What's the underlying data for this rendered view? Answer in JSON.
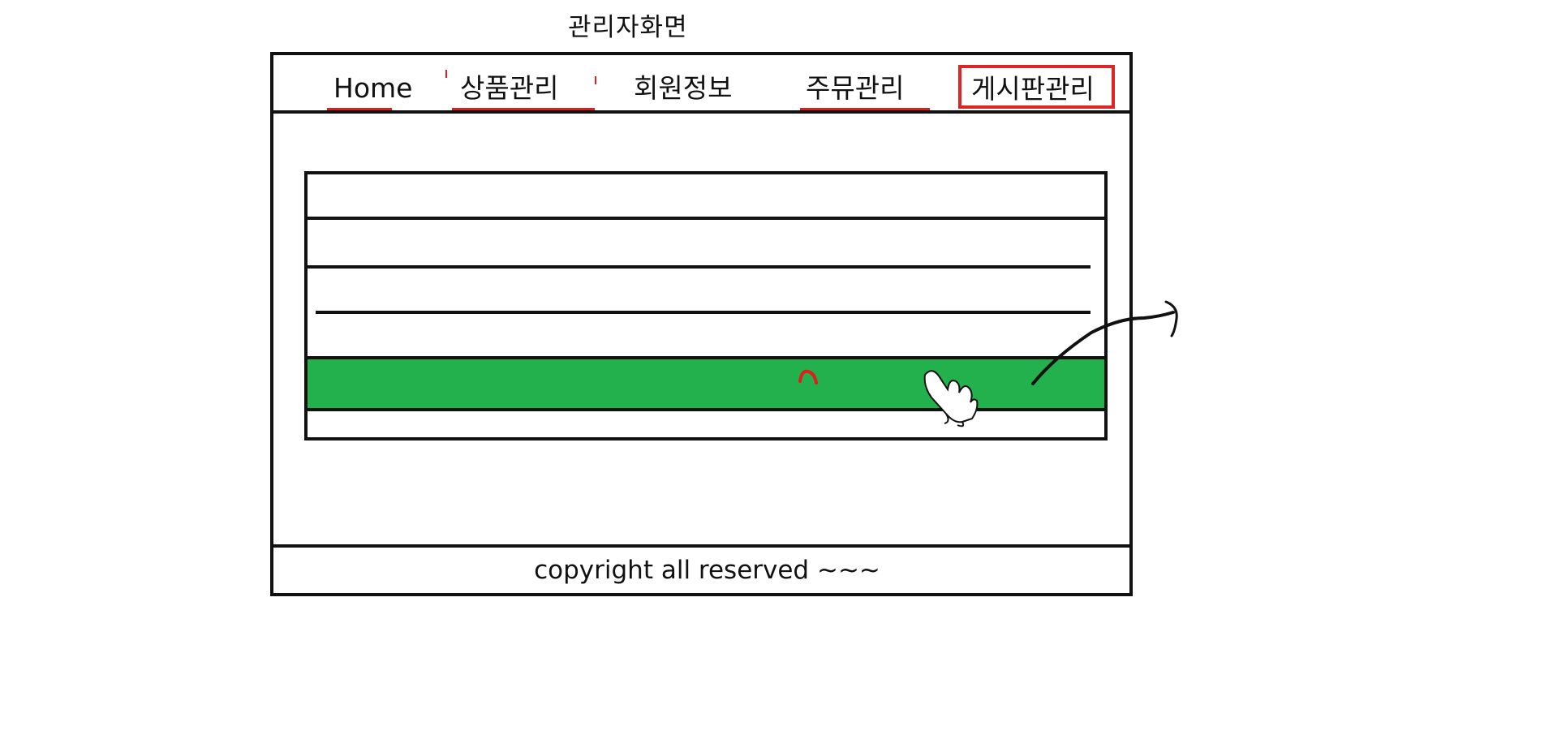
{
  "page_title": "관리자화면",
  "nav": {
    "items": [
      {
        "label": "Home"
      },
      {
        "label": "상품관리"
      },
      {
        "label": "회원정보"
      },
      {
        "label": "주뮤관리"
      },
      {
        "label": "게시판관리",
        "selected": true
      }
    ]
  },
  "table": {
    "highlight_color": "#22b14c",
    "highlighted_row": 4
  },
  "footer": {
    "text": "copyright all reserved ~~~"
  },
  "colors": {
    "accent": "#dc2626",
    "highlight": "#22b14c",
    "stroke": "#111111"
  },
  "icons": [
    "hand-cursor-icon",
    "arrow-annotation-icon"
  ]
}
